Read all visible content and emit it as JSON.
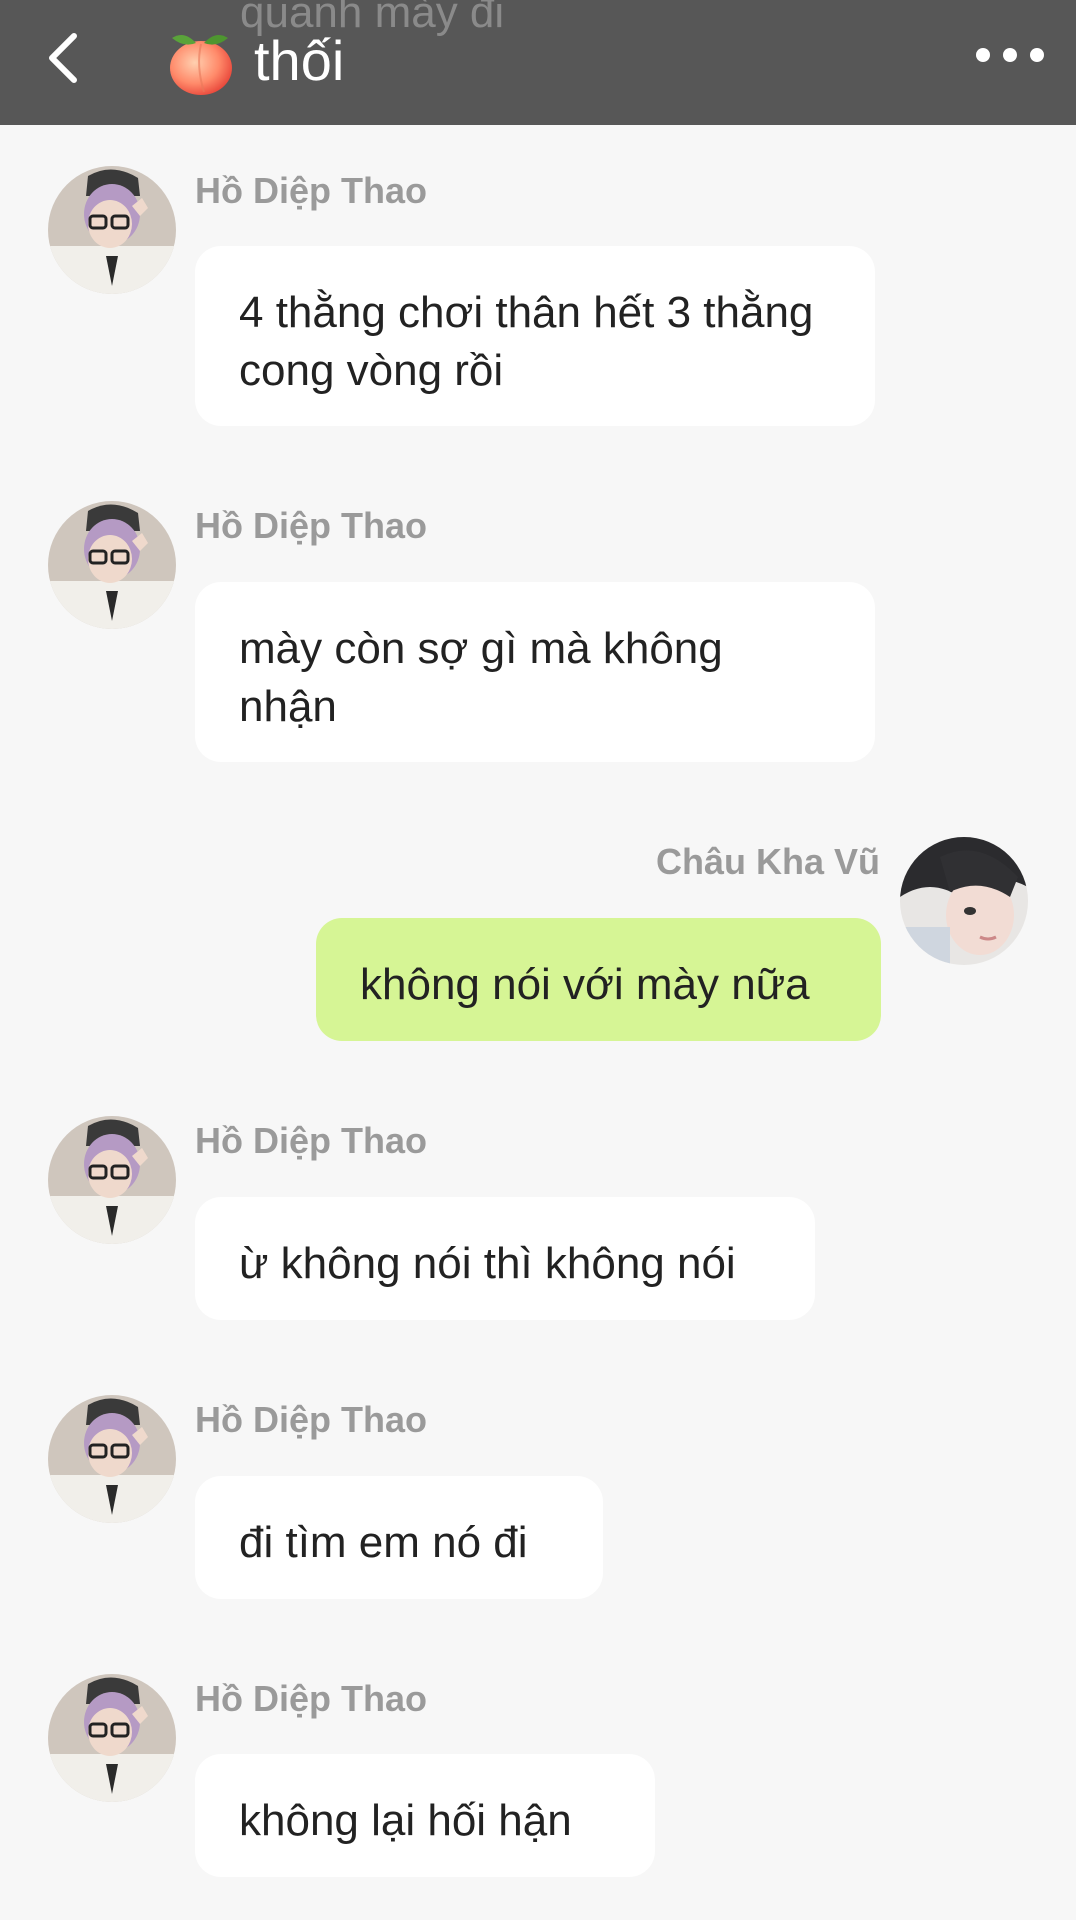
{
  "header": {
    "title": "thối",
    "partial_previous_text": "quanh mày đi",
    "back_icon": "chevron-left-icon",
    "emoji_icon": "peach-emoji-icon",
    "more_icon": "more-horizontal-icon"
  },
  "messages": [
    {
      "sender": "Hồ Diệp Thao",
      "text": "4 thằng chơi thân hết 3 thằng cong vòng rồi",
      "side": "left"
    },
    {
      "sender": "Hồ Diệp Thao",
      "text": "mày còn sợ gì mà không nhận",
      "side": "left"
    },
    {
      "sender": "Châu Kha Vũ",
      "text": "không nói với mày nữa",
      "side": "right"
    },
    {
      "sender": "Hồ Diệp Thao",
      "text": "ừ không nói thì không nói",
      "side": "left"
    },
    {
      "sender": "Hồ Diệp Thao",
      "text": "đi tìm em nó đi",
      "side": "left"
    },
    {
      "sender": "Hồ Diệp Thao",
      "text": "không lại hối hận",
      "side": "left"
    }
  ],
  "colors": {
    "header_bg": "#575757",
    "page_bg": "#f7f7f7",
    "bubble_other": "#ffffff",
    "bubble_mine": "#d6f595",
    "name_text": "#9a9a9a"
  }
}
